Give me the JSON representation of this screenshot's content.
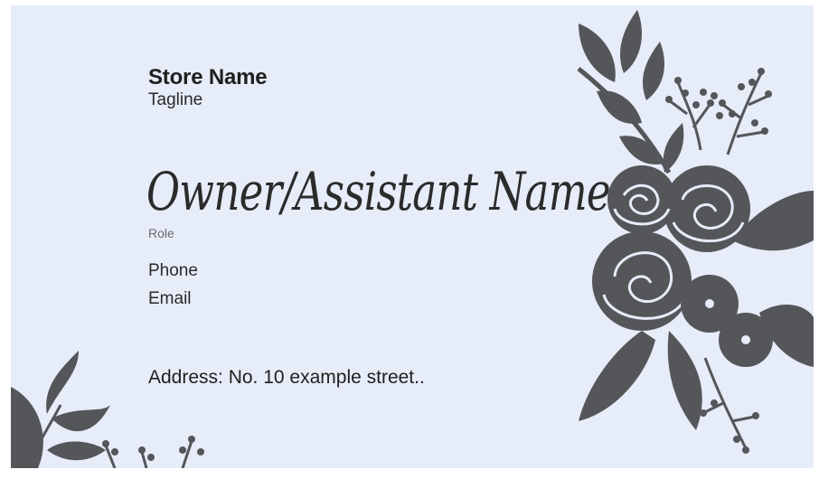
{
  "card": {
    "store_name": "Store Name",
    "tagline": "Tagline",
    "owner_name": "Owner/Assistant Name",
    "role": "Role",
    "phone": "Phone",
    "email": "Email",
    "address": "Address: No. 10 example street.."
  },
  "colors": {
    "background": "#e6ecf8",
    "floral": "#545659",
    "text": "#1f1f1f"
  },
  "icons": [
    "floral-bouquet-illustration",
    "leaf-sprig-illustration"
  ]
}
